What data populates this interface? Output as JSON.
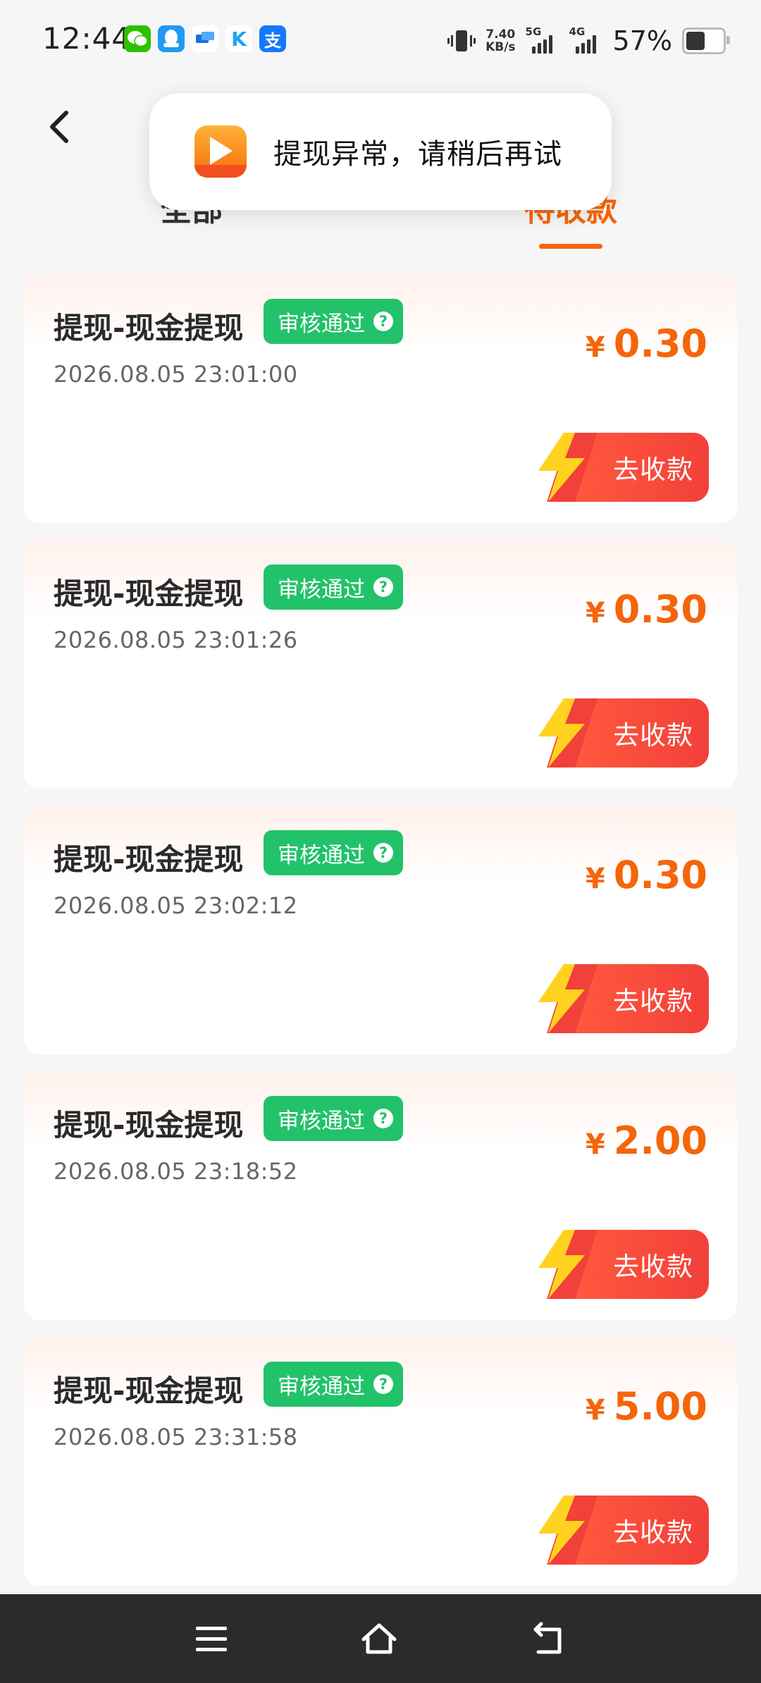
{
  "status_bar": {
    "time": "12:44",
    "net_speed_value": "7.40",
    "net_speed_unit": "KB/s",
    "signal_1_label": "5G",
    "signal_2_label": "4G",
    "battery_pct": "57%",
    "app_icons": [
      "wechat-icon",
      "qq-icon",
      "message-icon",
      "kuaishou-icon",
      "alipay-icon"
    ]
  },
  "header": {
    "tab_all": "全部",
    "tab_pending": "待收款",
    "active_color": "#f5650a"
  },
  "toast": {
    "message": "提现异常，请稍后再试"
  },
  "records": [
    {
      "title": "提现-现金提现",
      "badge": "审核通过",
      "time": "2026.08.05 23:01:00",
      "currency": "¥",
      "amount": "0.30",
      "action": "去收款"
    },
    {
      "title": "提现-现金提现",
      "badge": "审核通过",
      "time": "2026.08.05 23:01:26",
      "currency": "¥",
      "amount": "0.30",
      "action": "去收款"
    },
    {
      "title": "提现-现金提现",
      "badge": "审核通过",
      "time": "2026.08.05 23:02:12",
      "currency": "¥",
      "amount": "0.30",
      "action": "去收款"
    },
    {
      "title": "提现-现金提现",
      "badge": "审核通过",
      "time": "2026.08.05 23:18:52",
      "currency": "¥",
      "amount": "2.00",
      "action": "去收款"
    },
    {
      "title": "提现-现金提现",
      "badge": "审核通过",
      "time": "2026.08.05 23:31:58",
      "currency": "¥",
      "amount": "5.00",
      "action": "去收款"
    }
  ],
  "colors": {
    "badge_green": "#22c26a",
    "amount_orange": "#f5650a",
    "button_red": "#f2403a",
    "bolt_yellow": "#ffd21f"
  }
}
